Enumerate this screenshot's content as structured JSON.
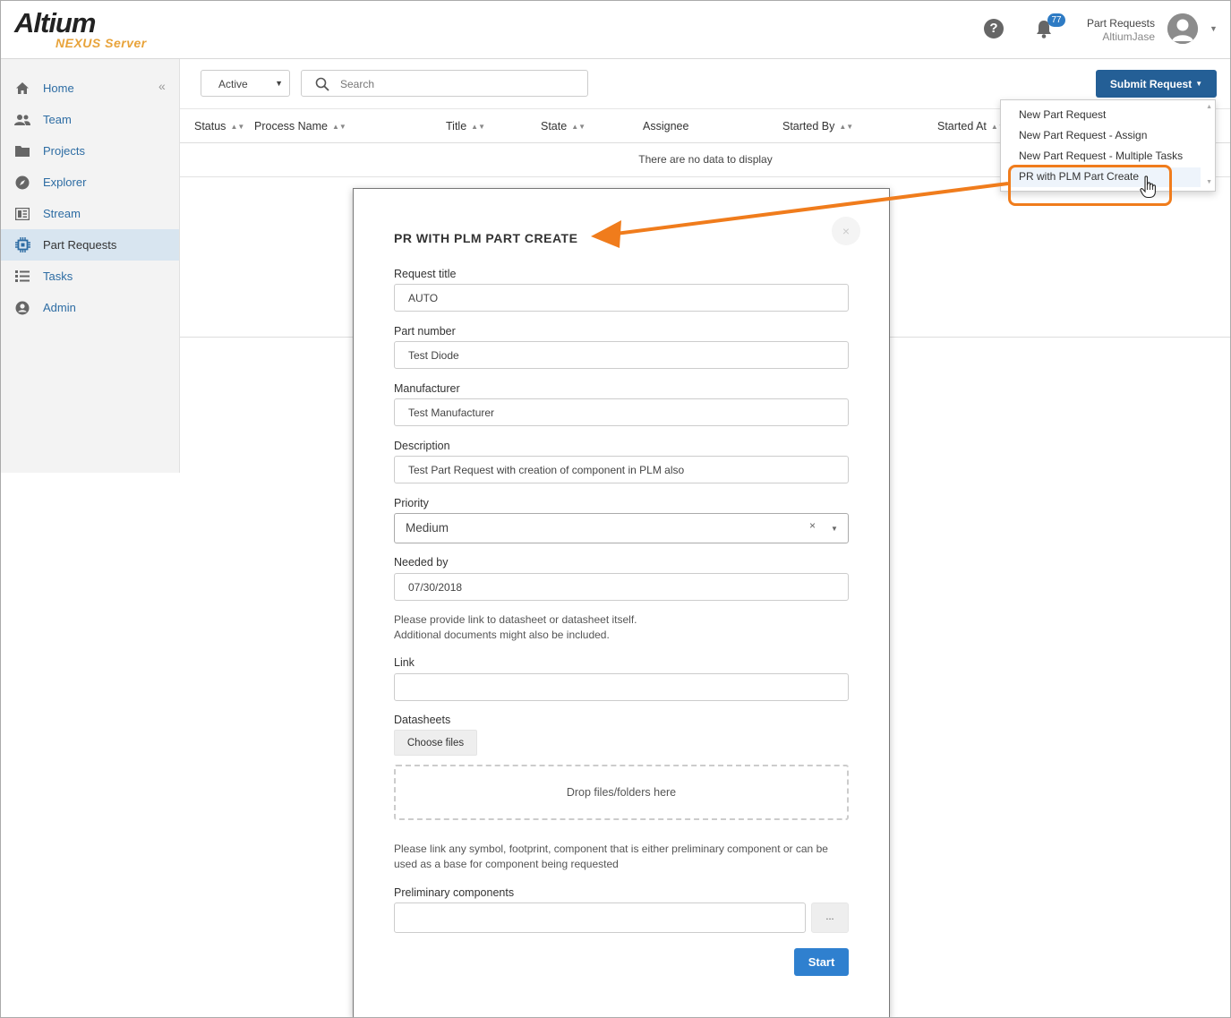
{
  "brand": {
    "name": "Altium",
    "product": "NEXUS Server"
  },
  "header": {
    "notification_count": "77",
    "user_title": "Part Requests",
    "user_name": "AltiumJase"
  },
  "sidebar": {
    "items": [
      {
        "label": "Home",
        "icon": "home-icon"
      },
      {
        "label": "Team",
        "icon": "team-icon"
      },
      {
        "label": "Projects",
        "icon": "folder-icon"
      },
      {
        "label": "Explorer",
        "icon": "compass-icon"
      },
      {
        "label": "Stream",
        "icon": "stream-icon"
      },
      {
        "label": "Part Requests",
        "icon": "chip-icon",
        "active": true
      },
      {
        "label": "Tasks",
        "icon": "tasks-icon"
      },
      {
        "label": "Admin",
        "icon": "user-circle-icon"
      }
    ]
  },
  "toolbar": {
    "filter_value": "Active",
    "search_placeholder": "Search",
    "submit_label": "Submit Request"
  },
  "table": {
    "columns": [
      "Status",
      "Process Name",
      "Title",
      "State",
      "Assignee",
      "Started By",
      "Started At"
    ],
    "empty_message": "There are no data to display"
  },
  "submit_menu": {
    "items": [
      "New Part Request",
      "New Part Request - Assign",
      "New Part Request - Multiple Tasks",
      "PR with PLM Part Create"
    ],
    "highlighted": "PR with PLM Part Create"
  },
  "accent_color": "#f07c1c",
  "modal": {
    "title": "PR WITH PLM PART CREATE",
    "close_label": "×",
    "request_title_label": "Request title",
    "request_title_value": "AUTO",
    "part_number_label": "Part number",
    "part_number_value": "Test Diode",
    "manufacturer_label": "Manufacturer",
    "manufacturer_value": "Test Manufacturer",
    "description_label": "Description",
    "description_value": "Test Part Request with creation of component in PLM also",
    "priority_label": "Priority",
    "priority_value": "Medium",
    "needed_by_label": "Needed by",
    "needed_by_value": "07/30/2018",
    "datasheet_note_1": "Please provide link to datasheet or datasheet itself.",
    "datasheet_note_2": "Additional documents might also be included.",
    "link_label": "Link",
    "link_value": "",
    "datasheets_label": "Datasheets",
    "choose_files_label": "Choose files",
    "drop_zone_label": "Drop files/folders here",
    "components_note_1": "Please link any symbol, footprint, component that is either preliminary component or can be",
    "components_note_2": "used as a base for component being requested",
    "preliminary_label": "Preliminary components",
    "browse_label": "...",
    "start_label": "Start"
  }
}
